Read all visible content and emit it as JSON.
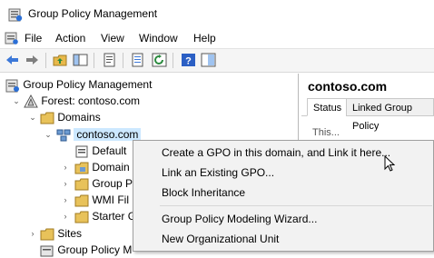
{
  "window": {
    "title": "Group Policy Management"
  },
  "menu": [
    "File",
    "Action",
    "View",
    "Window",
    "Help"
  ],
  "tree": {
    "root": "Group Policy Management",
    "forest": "Forest: contoso.com",
    "domains": "Domains",
    "domain": "contoso.com",
    "children": [
      "Default",
      "Domain",
      "Group P",
      "WMI Fil",
      "Starter G"
    ],
    "sites": "Sites",
    "modeling": "Group Policy M"
  },
  "right_pane": {
    "title": "contoso.com",
    "tabs": [
      "Status",
      "Linked Group Policy"
    ],
    "body_text": "This..."
  },
  "context_menu": {
    "items": [
      "Create a GPO in this domain, and Link it here...",
      "Link an Existing GPO...",
      "Block Inheritance",
      "Group Policy Modeling Wizard...",
      "New Organizational Unit"
    ]
  },
  "colors": {
    "selection": "#cce8ff",
    "menu_bg": "#f2f2f2",
    "toolbar_bg": "#f5f5f5"
  }
}
